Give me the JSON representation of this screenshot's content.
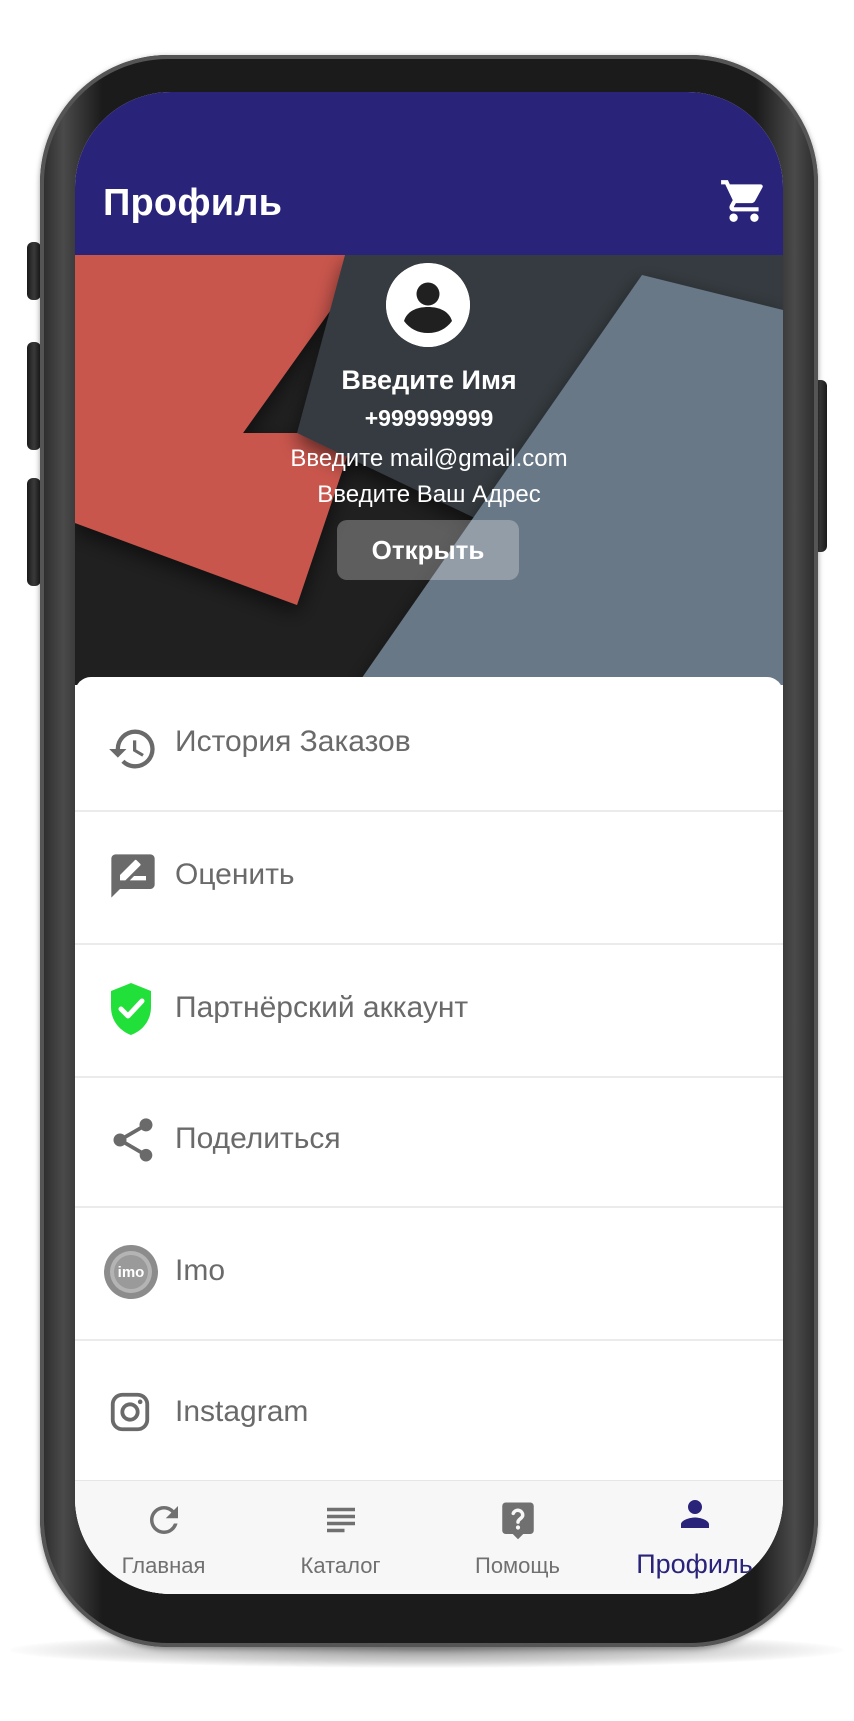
{
  "app_bar": {
    "title": "Профиль",
    "cart_icon": "shopping-cart-icon"
  },
  "profile": {
    "avatar_icon": "account-circle-icon",
    "name": "Введите Имя",
    "phone": "+999999999",
    "email": "Введите mail@gmail.com",
    "address": "Введите Ваш Адрес",
    "open_button": "Открыть"
  },
  "menu": {
    "items": [
      {
        "label": "История Заказов",
        "icon": "history-icon"
      },
      {
        "label": "Оценить",
        "icon": "rate-review-icon"
      },
      {
        "label": "Партнёрский аккаунт",
        "icon": "verified-shield-icon"
      },
      {
        "label": "Поделиться",
        "icon": "share-icon"
      },
      {
        "label": "Imo",
        "icon": "imo-icon",
        "icon_text": "imo"
      },
      {
        "label": "Instagram",
        "icon": "instagram-icon"
      }
    ]
  },
  "bottom_nav": {
    "items": [
      {
        "label": "Главная",
        "icon": "refresh-icon"
      },
      {
        "label": "Каталог",
        "icon": "list-icon"
      },
      {
        "label": "Помощь",
        "icon": "help-icon"
      },
      {
        "label": "Профиль",
        "icon": "person-icon",
        "active": true
      }
    ]
  },
  "colors": {
    "primary": "#29237a",
    "header_red": "#c9564e",
    "header_slate": "#343b40",
    "header_gray": "#687887",
    "shield_green": "#22e03a",
    "icon_gray": "#6a6a6a"
  }
}
